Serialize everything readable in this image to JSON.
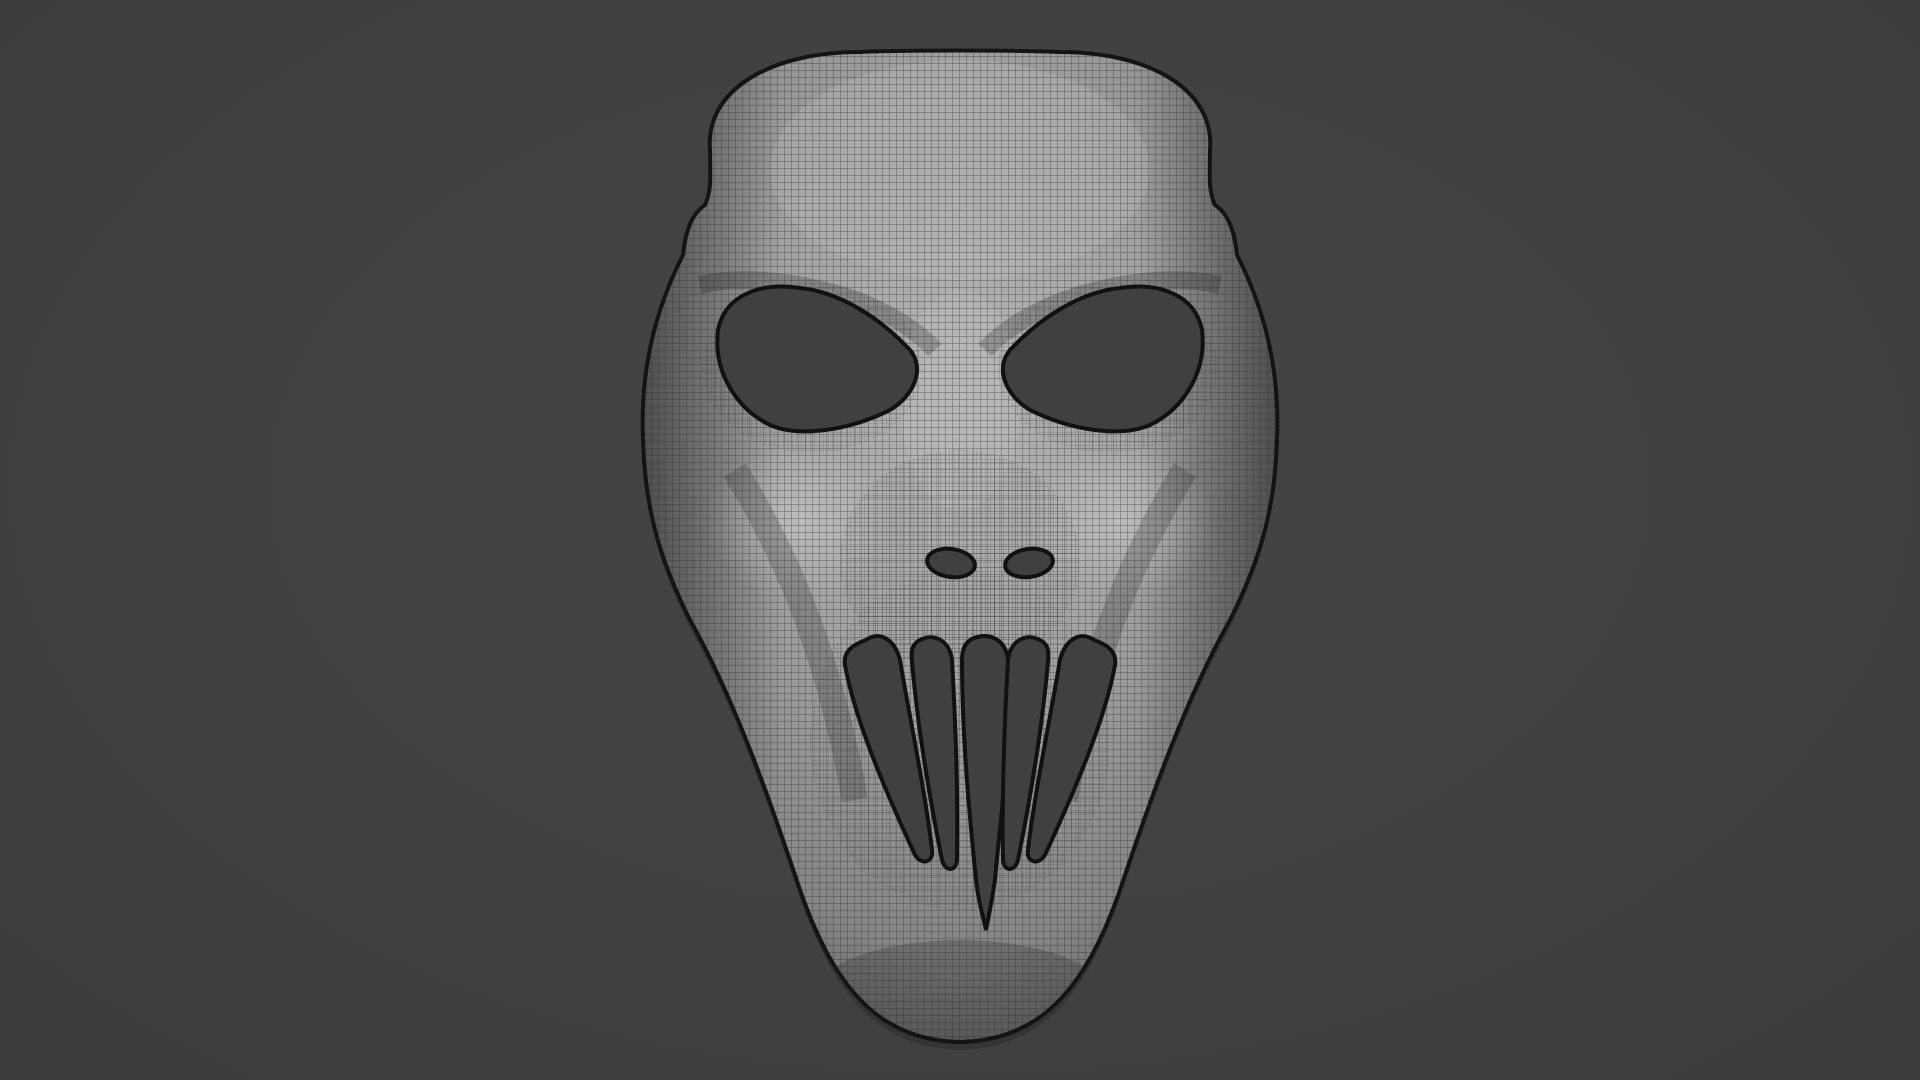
{
  "viewport": {
    "background_color": "#414141",
    "subject": "mask-mesh",
    "shading": "wireframe-on-shaded"
  },
  "mask": {
    "surface_color": "#9a9a9a",
    "wire_color": "#2a2a2a",
    "outline_color": "#121212",
    "hole_color": "#404040",
    "eye_holes": 2,
    "nose_holes": 2,
    "mouth_slots": 5
  }
}
